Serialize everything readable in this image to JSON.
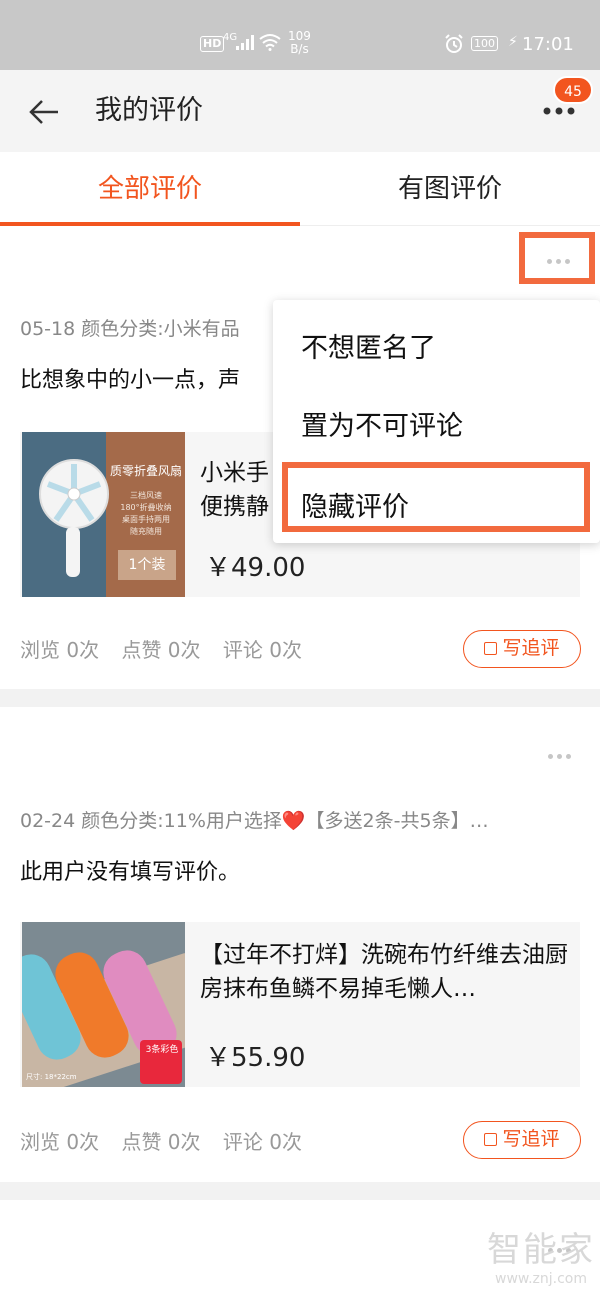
{
  "status_bar": {
    "hd": "HD",
    "network": "4G",
    "speed_value": "109",
    "speed_unit": "B/s",
    "battery": "100",
    "time": "17:01"
  },
  "header": {
    "title": "我的评价",
    "badge_count": "45"
  },
  "tabs": [
    {
      "label": "全部评价",
      "active": true
    },
    {
      "label": "有图评价",
      "active": false
    }
  ],
  "reviews": [
    {
      "meta": "05-18 颜色分类:小米有品",
      "text": "比想象中的小一点，声",
      "product": {
        "name": "小米手\n便携静",
        "price": "￥49.00",
        "image": {
          "title": "质零折叠风扇",
          "features": "三档风速\n180°折叠收纳\n桌面手持两用\n随充随用",
          "qty": "1个装"
        }
      },
      "stats": {
        "views": "浏览 0次",
        "likes": "点赞 0次",
        "comments": "评论 0次"
      },
      "followup_label": "写追评"
    },
    {
      "meta": "02-24 颜色分类:11%用户选择❤️【多送2条-共5条】…",
      "text": "此用户没有填写评价。",
      "product": {
        "name": "【过年不打烊】洗碗布竹纤维去油厨房抹布鱼鳞不易掉毛懒人…",
        "price": "￥55.90",
        "image": {
          "tag": "3条彩色",
          "size": "尺寸: 18*22cm"
        }
      },
      "stats": {
        "views": "浏览 0次",
        "likes": "点赞 0次",
        "comments": "评论 0次"
      },
      "followup_label": "写追评"
    }
  ],
  "popup_menu": {
    "items": [
      "不想匿名了",
      "置为不可评论",
      "隐藏评价"
    ],
    "highlighted_item": "隐藏评价"
  },
  "watermark": {
    "title": "智能家",
    "url": "www.znj.com"
  },
  "colors": {
    "accent": "#f2551f",
    "highlight_border": "#f26a3e",
    "status_bar": "#c8c8c8",
    "header_bg": "#f4f4f4"
  }
}
